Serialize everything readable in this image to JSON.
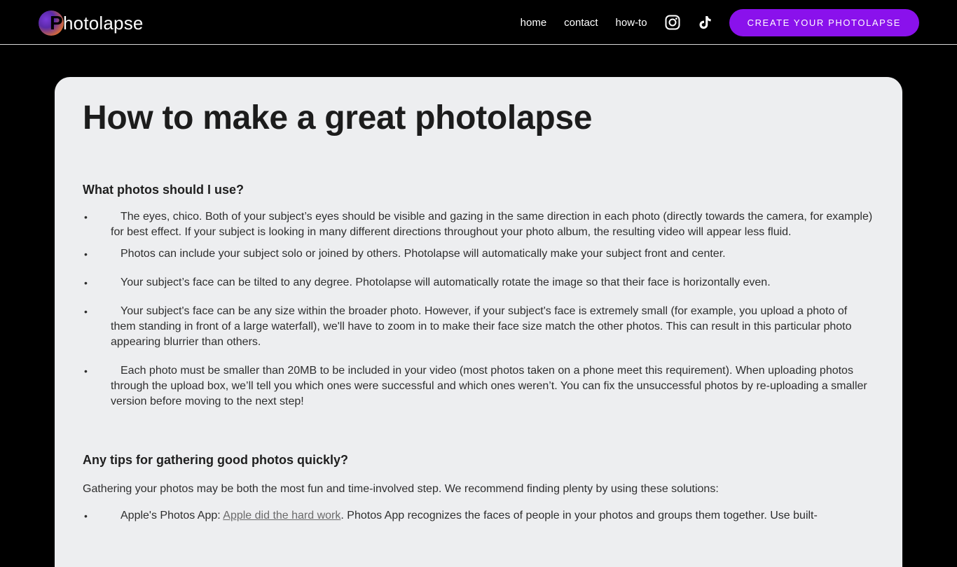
{
  "header": {
    "logo_text": "hotolapse",
    "logo_letter": "P",
    "nav": {
      "home": "home",
      "contact": "contact",
      "howto": "how-to"
    },
    "cta_label": "CREATE YOUR PHOTOLAPSE",
    "cta_color": "#8a11ec"
  },
  "main": {
    "title": "How to make a great photolapse",
    "section1": {
      "heading": "What photos should I use?",
      "items": [
        "The eyes, chico. Both of your subject’s eyes should be visible and gazing in the same direction in each photo (directly towards the camera, for example) for best effect. If your subject is looking in many different directions throughout your photo album, the resulting video will appear less fluid.",
        "Photos can include your subject solo or joined by others. Photolapse will automatically make your subject front and center.",
        "Your subject’s face can be tilted to any degree. Photolapse will automatically rotate the image so that their face is horizontally even.",
        "Your subject's face can be any size within the broader photo. However, if your subject's face is extremely small (for example, you upload a photo of them standing in front of a large waterfall), we'll have to zoom in to make their face size match the other photos. This can result in this particular photo appearing blurrier than others.",
        "Each photo must be smaller than 20MB to be included in your video (most photos taken on a phone meet this requirement). When uploading photos through the upload box, we’ll tell you which ones were successful and which ones weren’t. You can fix the unsuccessful photos by re-uploading a smaller version before moving to the next step!"
      ]
    },
    "section2": {
      "heading": "Any tips for gathering good photos quickly?",
      "intro": "Gathering your photos may be both the most fun and time-involved step. We recommend finding plenty by using these solutions:",
      "item1_prefix": "Apple's Photos App: ",
      "item1_link": "Apple did the hard work",
      "item1_suffix": ". Photos App recognizes the faces of people in your photos and groups them together. Use built-"
    }
  }
}
